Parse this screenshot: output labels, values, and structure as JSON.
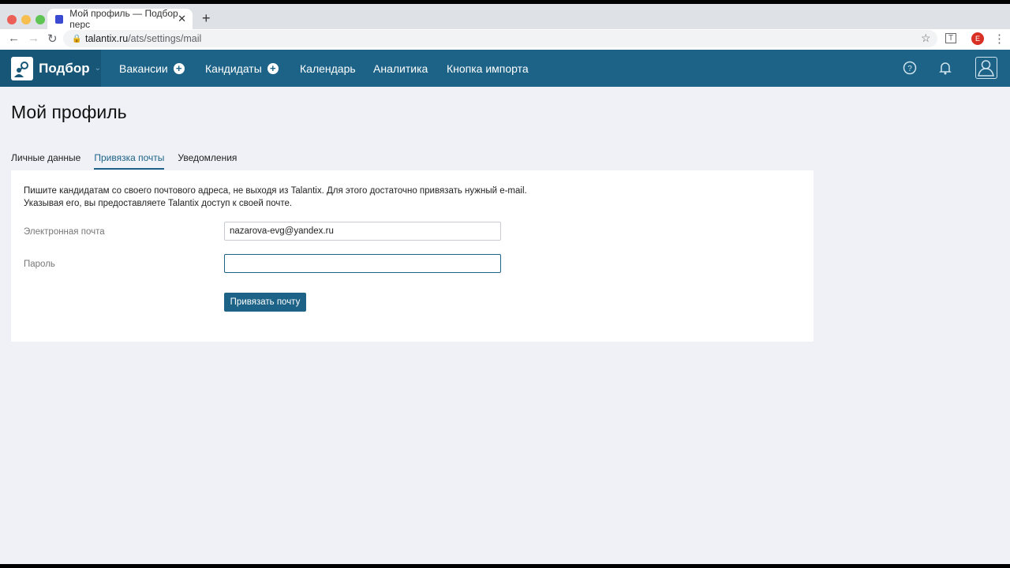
{
  "browser": {
    "tab_title": "Мой профиль — Подбор перс",
    "url_host": "talantix.ru",
    "url_path": "/ats/settings/mail",
    "profile_initial": "E",
    "extension_label": "T"
  },
  "nav": {
    "brand": "Подбор",
    "items": [
      {
        "label": "Вакансии"
      },
      {
        "label": "Кандидаты"
      },
      {
        "label": "Календарь"
      },
      {
        "label": "Аналитика"
      },
      {
        "label": "Кнопка импорта"
      }
    ]
  },
  "page": {
    "title": "Мой профиль",
    "tabs": [
      {
        "label": "Личные данные"
      },
      {
        "label": "Привязка почты"
      },
      {
        "label": "Уведомления"
      }
    ],
    "intro_line1": "Пишите кандидатам со своего почтового адреса, не выходя из Talantix. Для этого достаточно привязать нужный e-mail.",
    "intro_line2": "Указывая его, вы предоставляете Talantix доступ к своей почте.",
    "email_label": "Электронная почта",
    "email_value": "nazarova-evg@yandex.ru",
    "password_label": "Пароль",
    "password_value": "",
    "submit_label": "Привязать почту"
  }
}
